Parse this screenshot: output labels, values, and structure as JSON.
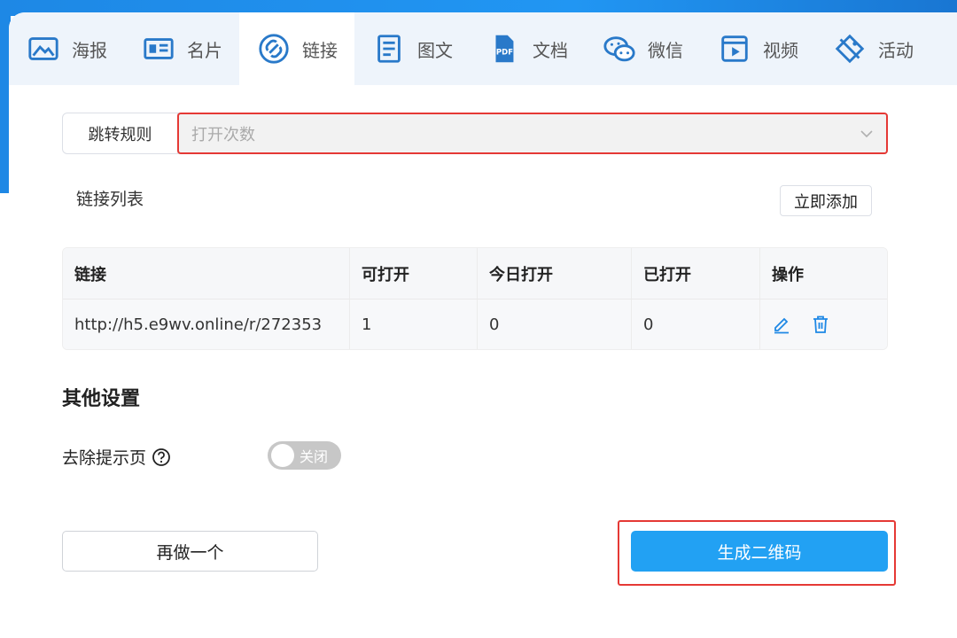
{
  "tabs": [
    {
      "label": "海报",
      "icon": "poster-icon"
    },
    {
      "label": "名片",
      "icon": "business-card-icon"
    },
    {
      "label": "链接",
      "icon": "link-icon"
    },
    {
      "label": "图文",
      "icon": "article-icon"
    },
    {
      "label": "文档",
      "icon": "pdf-document-icon"
    },
    {
      "label": "微信",
      "icon": "wechat-icon"
    },
    {
      "label": "视频",
      "icon": "video-icon"
    },
    {
      "label": "活动",
      "icon": "activity-icon"
    }
  ],
  "active_tab": "链接",
  "rule": {
    "label": "跳转规则",
    "placeholder": "打开次数"
  },
  "link_list": {
    "title": "链接列表",
    "add_label": "立即添加",
    "headers": [
      "链接",
      "可打开",
      "今日打开",
      "已打开",
      "操作"
    ],
    "rows": [
      [
        "http://h5.e9wv.online/r/272353",
        "1",
        "0",
        "0"
      ]
    ]
  },
  "other": {
    "title": "其他设置",
    "remove_hint_label": "去除提示页",
    "toggle_label": "关闭"
  },
  "actions": {
    "redo_label": "再做一个",
    "generate_label": "生成二维码"
  },
  "colors": {
    "primary": "#22a1f3",
    "highlight_border": "#e53935",
    "accent_blue": "#1e88e5"
  }
}
